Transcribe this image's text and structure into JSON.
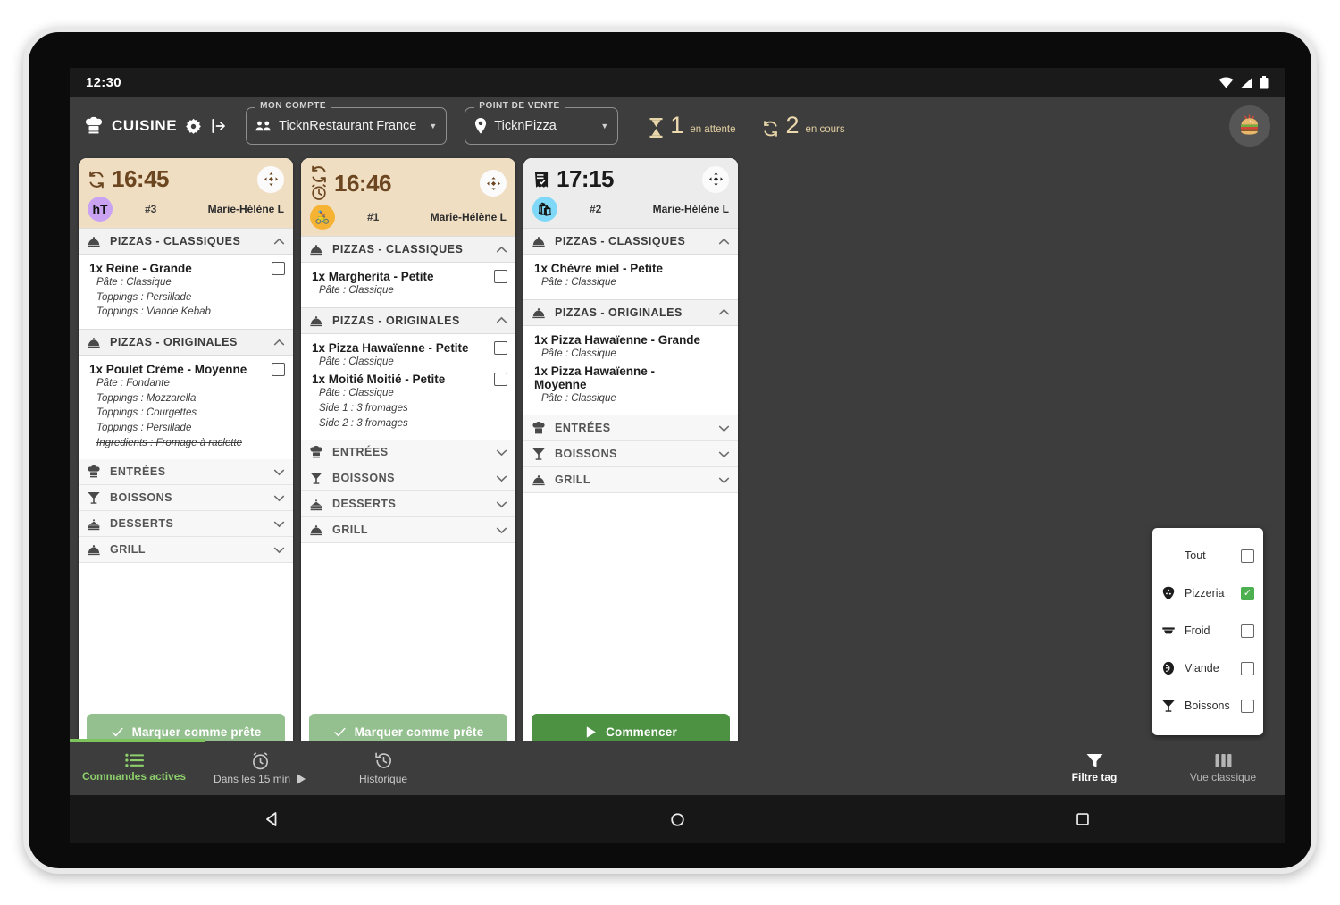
{
  "status_bar": {
    "clock": "12:30",
    "icons": [
      "wifi-icon",
      "signal-icon",
      "battery-icon"
    ]
  },
  "header": {
    "brand_label": "CUISINE",
    "brand_icon": "chef-hat-icon",
    "settings_icon": "gear-icon",
    "logout_icon": "logout-icon",
    "account": {
      "legend": "MON COMPTE",
      "value": "TicknRestaurant France",
      "icon": "people-icon",
      "caret": "▼"
    },
    "point_of_sale": {
      "legend": "POINT DE VENTE",
      "value": "TicknPizza",
      "icon": "map-pin-icon",
      "caret": "▼"
    },
    "counters": [
      {
        "icon": "hourglass-icon",
        "count": "1",
        "label": "en attente"
      },
      {
        "icon": "refresh-icon",
        "count": "2",
        "label": "en cours"
      }
    ],
    "avatar": "burger-avatar"
  },
  "orders": [
    {
      "time": "16:45",
      "head_style": "beige",
      "head_icons": [
        "refresh-icon"
      ],
      "badge": {
        "text": "hT",
        "color": "purple",
        "name": "channel-badge-ht"
      },
      "number": "#3",
      "customer": "Marie-Hélène L",
      "move_icon": "move-icon",
      "sections": [
        {
          "label": "PIZZAS - CLASSIQUES",
          "icon": "dome-icon",
          "expanded": true,
          "items": [
            {
              "name": "1x Reine - Grande",
              "checkbox": true,
              "options": [
                {
                  "text": "Pâte : Classique",
                  "struck": false
                },
                {
                  "text": "Toppings : Persillade",
                  "struck": false
                },
                {
                  "text": "Toppings : Viande Kebab",
                  "struck": false
                }
              ]
            }
          ]
        },
        {
          "label": "PIZZAS - ORIGINALES",
          "icon": "dome-icon",
          "expanded": true,
          "items": [
            {
              "name": "1x Poulet Crème - Moyenne",
              "checkbox": true,
              "options": [
                {
                  "text": "Pâte : Fondante",
                  "struck": false
                },
                {
                  "text": "Toppings : Mozzarella",
                  "struck": false
                },
                {
                  "text": "Toppings : Courgettes",
                  "struck": false
                },
                {
                  "text": "Toppings : Persillade",
                  "struck": false
                },
                {
                  "text": "Ingredients : Fromage à raclette",
                  "struck": true
                }
              ]
            }
          ]
        },
        {
          "label": "ENTRÉES",
          "icon": "chef-hat-icon",
          "expanded": false,
          "items": []
        },
        {
          "label": "BOISSONS",
          "icon": "cocktail-icon",
          "expanded": false,
          "items": []
        },
        {
          "label": "DESSERTS",
          "icon": "cake-icon",
          "expanded": false,
          "items": []
        },
        {
          "label": "GRILL",
          "icon": "dome-icon",
          "expanded": false,
          "items": []
        }
      ],
      "cta": {
        "label": "Marquer comme prête",
        "icon": "check-icon",
        "style": "pale"
      }
    },
    {
      "time": "16:46",
      "head_style": "beige",
      "head_icons": [
        "refresh-icon",
        "alarm-icon"
      ],
      "badge": {
        "text": "🚴",
        "color": "orange",
        "name": "channel-badge-delivery"
      },
      "number": "#1",
      "customer": "Marie-Hélène L",
      "move_icon": "move-icon",
      "sections": [
        {
          "label": "PIZZAS - CLASSIQUES",
          "icon": "dome-icon",
          "expanded": true,
          "items": [
            {
              "name": "1x Margherita - Petite",
              "checkbox": true,
              "options": [
                {
                  "text": "Pâte : Classique",
                  "struck": false
                }
              ]
            }
          ]
        },
        {
          "label": "PIZZAS - ORIGINALES",
          "icon": "dome-icon",
          "expanded": true,
          "items": [
            {
              "name": "1x Pizza Hawaïenne - Petite",
              "checkbox": true,
              "options": [
                {
                  "text": "Pâte : Classique",
                  "struck": false
                }
              ]
            },
            {
              "name": "1x Moitié Moitié - Petite",
              "checkbox": true,
              "options": [
                {
                  "text": "Pâte : Classique",
                  "struck": false
                },
                {
                  "text": "Side 1 : 3 fromages",
                  "struck": false
                },
                {
                  "text": "Side 2 : 3 fromages",
                  "struck": false
                }
              ]
            }
          ]
        },
        {
          "label": "ENTRÉES",
          "icon": "chef-hat-icon",
          "expanded": false,
          "items": []
        },
        {
          "label": "BOISSONS",
          "icon": "cocktail-icon",
          "expanded": false,
          "items": []
        },
        {
          "label": "DESSERTS",
          "icon": "cake-icon",
          "expanded": false,
          "items": []
        },
        {
          "label": "GRILL",
          "icon": "dome-icon",
          "expanded": false,
          "items": []
        }
      ],
      "cta": {
        "label": "Marquer comme prête",
        "icon": "check-icon",
        "style": "pale"
      }
    },
    {
      "time": "17:15",
      "head_style": "grey",
      "head_icons": [
        "receipt-icon"
      ],
      "badge": {
        "text": "🛍",
        "color": "blue",
        "name": "channel-badge-takeaway"
      },
      "number": "#2",
      "customer": "Marie-Hélène L",
      "move_icon": "move-icon",
      "sections": [
        {
          "label": "PIZZAS - CLASSIQUES",
          "icon": "dome-icon",
          "expanded": true,
          "items": [
            {
              "name": "1x Chèvre miel - Petite",
              "checkbox": false,
              "options": [
                {
                  "text": "Pâte : Classique",
                  "struck": false
                }
              ]
            }
          ]
        },
        {
          "label": "PIZZAS - ORIGINALES",
          "icon": "dome-icon",
          "expanded": true,
          "items": [
            {
              "name": "1x Pizza Hawaïenne - Grande",
              "checkbox": false,
              "options": [
                {
                  "text": "Pâte : Classique",
                  "struck": false
                }
              ]
            },
            {
              "name": "1x Pizza Hawaïenne - Moyenne",
              "checkbox": false,
              "options": [
                {
                  "text": "Pâte : Classique",
                  "struck": false
                }
              ]
            }
          ]
        },
        {
          "label": "ENTRÉES",
          "icon": "chef-hat-icon",
          "expanded": false,
          "items": []
        },
        {
          "label": "BOISSONS",
          "icon": "cocktail-icon",
          "expanded": false,
          "items": []
        },
        {
          "label": "GRILL",
          "icon": "dome-icon",
          "expanded": false,
          "items": []
        }
      ],
      "cta": {
        "label": "Commencer",
        "icon": "play-icon",
        "style": "solid"
      }
    }
  ],
  "tag_filter": {
    "rows": [
      {
        "label": "Tout",
        "icon": "",
        "checked": false
      },
      {
        "label": "Pizzeria",
        "icon": "pizza-slice-icon",
        "checked": true
      },
      {
        "label": "Froid",
        "icon": "fridge-icon",
        "checked": false
      },
      {
        "label": "Viande",
        "icon": "meat-icon",
        "checked": false
      },
      {
        "label": "Boissons",
        "icon": "cocktail-icon",
        "checked": false
      }
    ],
    "check_glyph": "✓"
  },
  "bottom_nav": {
    "left": [
      {
        "label": "Commandes actives",
        "icon": "list-icon",
        "state": "active"
      },
      {
        "label": "Dans les 15 min",
        "icon": "alarm-clock-icon",
        "state": "dim",
        "suffix_icon": "play-icon"
      },
      {
        "label": "Historique",
        "icon": "history-icon",
        "state": "dim"
      }
    ],
    "right": [
      {
        "label": "Filtre tag",
        "icon": "funnel-icon",
        "state": "white"
      },
      {
        "label": "Vue classique",
        "icon": "columns-icon",
        "state": "grey"
      }
    ]
  },
  "android_nav": {
    "back": "back-triangle-icon",
    "home": "home-circle-icon",
    "recents": "recents-square-icon"
  },
  "colors": {
    "accent_green": "#4d9243",
    "pale_green": "#94c08f",
    "beige_card": "#f0dec3",
    "dark_chrome": "#3d3d3d",
    "gold_text": "#ecd9ae"
  }
}
